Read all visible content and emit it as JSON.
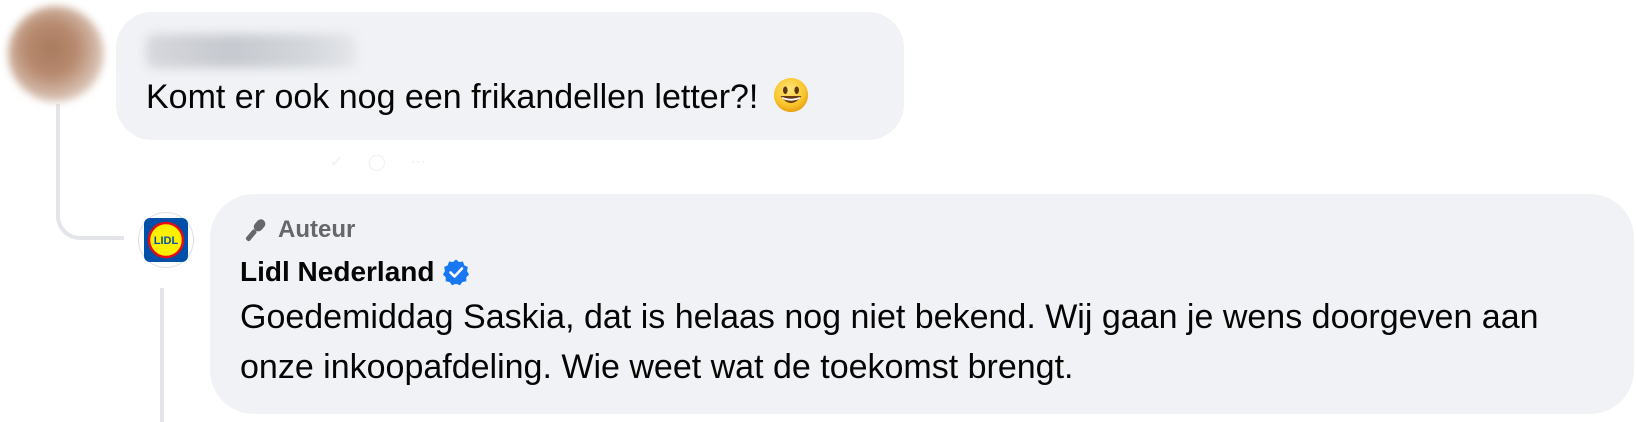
{
  "comment": {
    "text": "Komt er ook nog een frikandellen letter?!",
    "emoji": "grinning-face-emoji"
  },
  "reply": {
    "badge_label": "Auteur",
    "badge_icon": "microphone-icon",
    "page_name": "Lidl Nederland",
    "verified_icon": "verified-badge-icon",
    "text": "Goedemiddag Saskia, dat is helaas nog niet bekend. Wij gaan je wens doorgeven aan onze inkoopafdeling. Wie weet wat de toekomst brengt."
  },
  "colors": {
    "bubble": "#f0f2f5",
    "verified": "#1877f2",
    "secondary_text": "#65676b",
    "primary_text": "#050505",
    "lidl_blue": "#0050aa",
    "lidl_yellow": "#fff000",
    "lidl_red": "#e60a14"
  }
}
